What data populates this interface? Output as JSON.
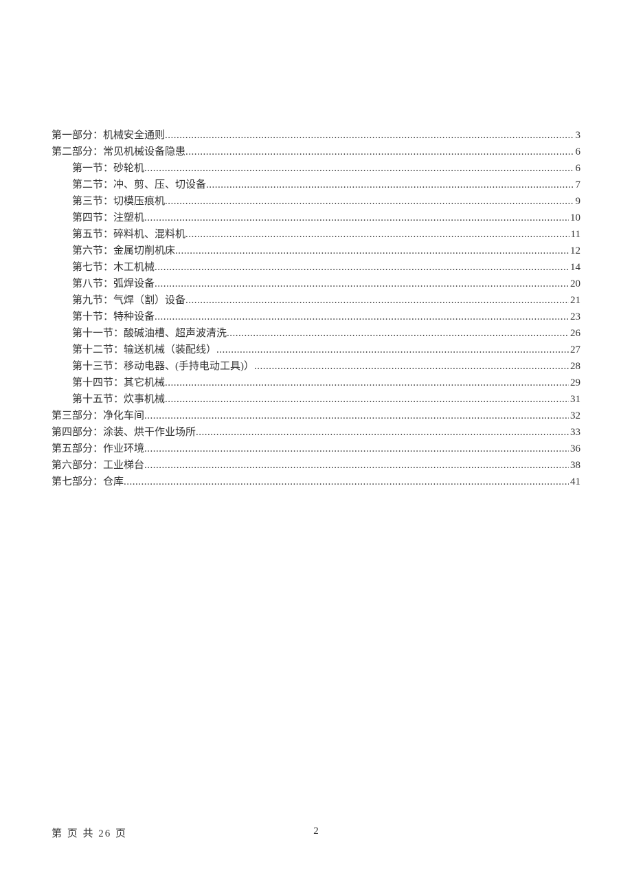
{
  "toc": [
    {
      "level": 1,
      "text": "第一部分：机械安全通则",
      "page": "3"
    },
    {
      "level": 1,
      "text": "第二部分：常见机械设备隐患",
      "page": "6"
    },
    {
      "level": 2,
      "text": "第一节：砂轮机",
      "page": "6"
    },
    {
      "level": 2,
      "text": "第二节：冲、剪、压、切设备",
      "page": "7"
    },
    {
      "level": 2,
      "text": "第三节：切模压痕机",
      "page": "9"
    },
    {
      "level": 2,
      "text": "第四节：注塑机",
      "page": "10"
    },
    {
      "level": 2,
      "text": "第五节：碎料机、混料机",
      "page": "11"
    },
    {
      "level": 2,
      "text": "第六节：金属切削机床",
      "page": "12"
    },
    {
      "level": 2,
      "text": "第七节：木工机械",
      "page": "14"
    },
    {
      "level": 2,
      "text": "第八节：弧焊设备",
      "page": "20"
    },
    {
      "level": 2,
      "text": "第九节：气焊（割）设备",
      "page": "21"
    },
    {
      "level": 2,
      "text": "第十节：特种设备",
      "page": "23"
    },
    {
      "level": 2,
      "text": "第十一节：酸碱油槽、超声波清洗",
      "page": "26"
    },
    {
      "level": 2,
      "text": "第十二节：输送机械（装配线）",
      "page": "27"
    },
    {
      "level": 2,
      "text": "第十三节：移动电器、(手持电动工具)）",
      "page": "28"
    },
    {
      "level": 2,
      "text": "第十四节：其它机械",
      "page": "29"
    },
    {
      "level": 2,
      "text": "第十五节：炊事机械",
      "page": "31"
    },
    {
      "level": 1,
      "text": "第三部分：净化车间",
      "page": "32"
    },
    {
      "level": 1,
      "text": "第四部分：涂装、烘干作业场所",
      "page": "33"
    },
    {
      "level": 1,
      "text": "第五部分：作业环境",
      "page": "36"
    },
    {
      "level": 1,
      "text": "第六部分：工业梯台",
      "page": "38"
    },
    {
      "level": 1,
      "text": "第七部分：仓库",
      "page": "41"
    }
  ],
  "footer": {
    "left": "第  页 共 26 页",
    "center": "2"
  }
}
